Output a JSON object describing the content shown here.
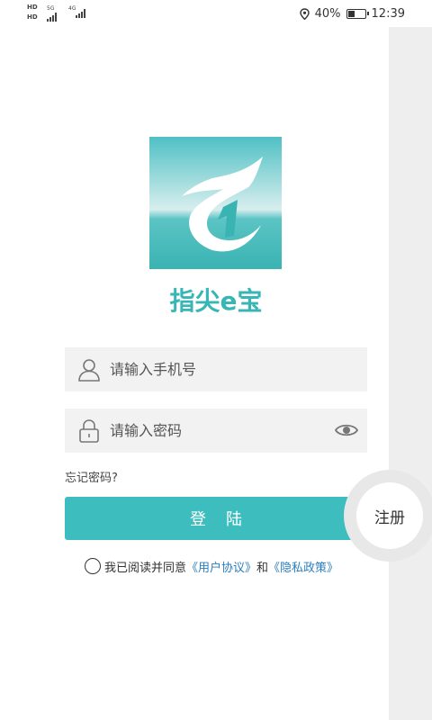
{
  "status_bar": {
    "hd1": "HD",
    "hd2": "HD",
    "net1": "5G",
    "net2": "4G",
    "battery_percent": "40%",
    "battery_level": 0.4,
    "time": "12:39"
  },
  "app": {
    "name": "指尖e宝",
    "brand_color": "#3dbdbd"
  },
  "login": {
    "phone_placeholder": "请输入手机号",
    "password_placeholder": "请输入密码",
    "forgot_label": "忘记密码?",
    "login_label": "登陆",
    "register_label": "注册"
  },
  "agreement": {
    "prefix": "我已阅读并同意",
    "user_agreement": "《用户协议》",
    "conjunction": "和",
    "privacy_policy": "《隐私政策》"
  },
  "icons": {
    "phone_field": "user-icon",
    "password_field": "lock-icon",
    "toggle_visibility": "eye-icon",
    "location": "location-icon",
    "battery": "battery-icon"
  }
}
